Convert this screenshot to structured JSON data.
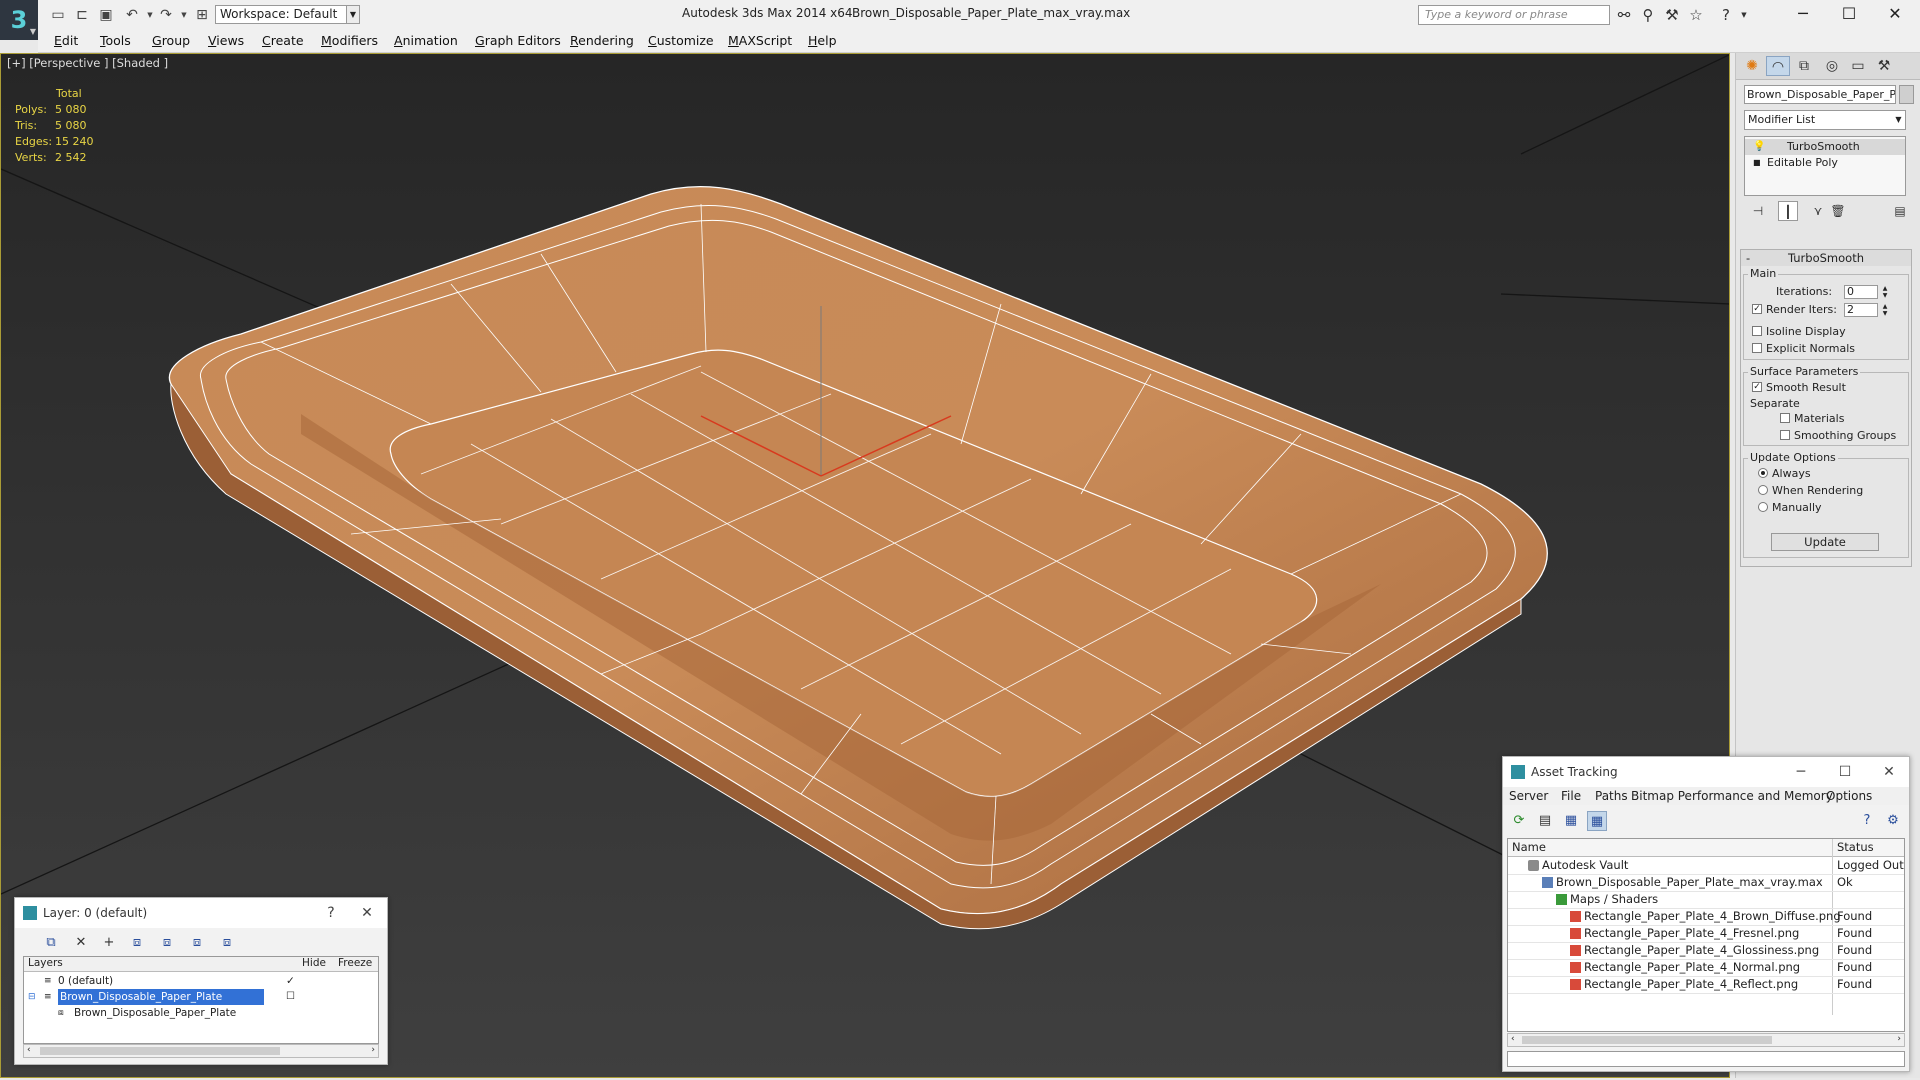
{
  "app": {
    "title": "Autodesk 3ds Max  2014 x64",
    "file": "Brown_Disposable_Paper_Plate_max_vray.max",
    "logo": "3",
    "workspace": "Workspace: Default",
    "search_placeholder": "Type a keyword or phrase",
    "icons": [
      "new-file-icon",
      "open-file-icon",
      "save-icon",
      "undo-icon",
      "redo-icon",
      "project-folder-icon",
      "binoculars-icon",
      "search-options-icon",
      "star-icon",
      "help-icon"
    ]
  },
  "menu": [
    "Edit",
    "Tools",
    "Group",
    "Views",
    "Create",
    "Modifiers",
    "Animation",
    "Graph Editors",
    "Rendering",
    "Customize",
    "MAXScript",
    "Help"
  ],
  "viewport": {
    "label": "[+] [Perspective ] [Shaded ]",
    "stats": {
      "header": "Total",
      "rows": [
        {
          "k": "Polys:",
          "v": "5 080"
        },
        {
          "k": "Tris:",
          "v": "5 080"
        },
        {
          "k": "Edges:",
          "v": "15 240"
        },
        {
          "k": "Verts:",
          "v": "2 542"
        }
      ]
    },
    "colors": {
      "plate_fill": "#c98b58",
      "wire": "#ffffff",
      "border": "#aa9c36"
    }
  },
  "command_panel": {
    "object_name": "Brown_Disposable_Paper_Pla",
    "modifier_list": "Modifier List",
    "stack": [
      "TurboSmooth",
      "Editable Poly"
    ],
    "rollout": {
      "title": "TurboSmooth",
      "main": {
        "title": "Main",
        "iterations_label": "Iterations:",
        "iterations": "0",
        "render_iters_label": "Render Iters:",
        "render_iters": "2",
        "isoline": "Isoline Display",
        "explicit": "Explicit Normals"
      },
      "surface": {
        "title": "Surface Parameters",
        "smooth": "Smooth Result",
        "separate": "Separate",
        "materials": "Materials",
        "smoothing_groups": "Smoothing Groups"
      },
      "update": {
        "title": "Update Options",
        "always": "Always",
        "when_rendering": "When Rendering",
        "manually": "Manually",
        "button": "Update"
      }
    }
  },
  "layer_dialog": {
    "title": "Layer: 0 (default)",
    "help": "?",
    "columns": {
      "layers": "Layers",
      "hide": "Hide",
      "freeze": "Freeze"
    },
    "rows": [
      {
        "name": "0 (default)"
      },
      {
        "name": "Brown_Disposable_Paper_Plate"
      },
      {
        "name": "Brown_Disposable_Paper_Plate"
      }
    ]
  },
  "asset_tracking": {
    "title": "Asset Tracking",
    "menu": [
      "Server",
      "File",
      "Paths",
      "Bitmap Performance and Memory",
      "Options"
    ],
    "columns": {
      "name": "Name",
      "status": "Status"
    },
    "rows": [
      {
        "name": "Autodesk Vault",
        "status": "Logged Out"
      },
      {
        "name": "Brown_Disposable_Paper_Plate_max_vray.max",
        "status": "Ok"
      },
      {
        "name": "Maps / Shaders",
        "status": ""
      },
      {
        "name": "Rectangle_Paper_Plate_4_Brown_Diffuse.png",
        "status": "Found"
      },
      {
        "name": "Rectangle_Paper_Plate_4_Fresnel.png",
        "status": "Found"
      },
      {
        "name": "Rectangle_Paper_Plate_4_Glossiness.png",
        "status": "Found"
      },
      {
        "name": "Rectangle_Paper_Plate_4_Normal.png",
        "status": "Found"
      },
      {
        "name": "Rectangle_Paper_Plate_4_Reflect.png",
        "status": "Found"
      }
    ]
  }
}
